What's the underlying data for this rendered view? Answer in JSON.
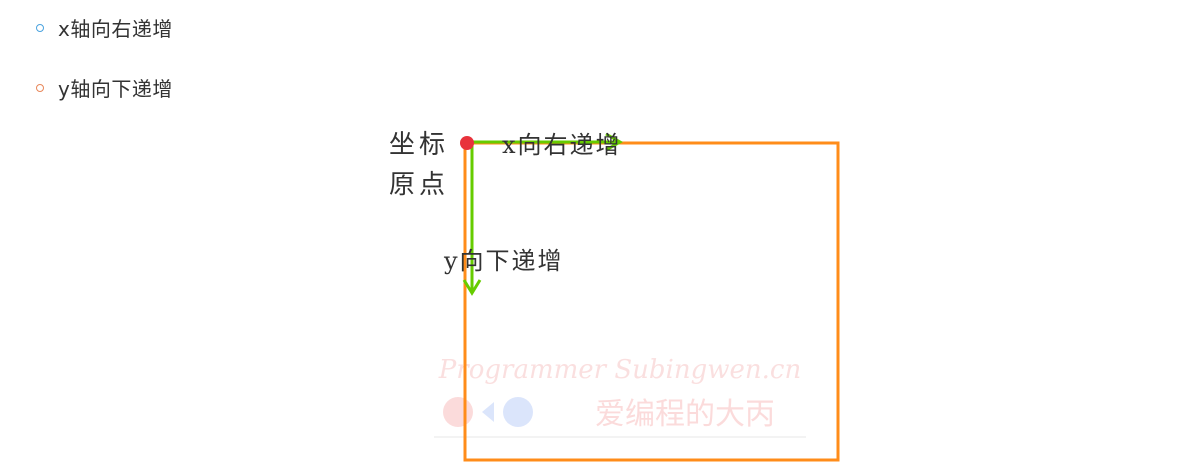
{
  "bullets": [
    {
      "text": "x轴向右递增",
      "marker_color": "#4aa3df"
    },
    {
      "text": "y轴向下递增",
      "marker_color": "#e8875a"
    }
  ],
  "diagram": {
    "origin_label_line1": "坐标",
    "origin_label_line2": "原点",
    "x_axis_label": "x向右递增",
    "y_axis_label": "y向下递增",
    "watermark_line1": "Programmer Subingwen.cn",
    "watermark_line2": "爱编程的大丙",
    "colors": {
      "rect": "#ff8c1a",
      "axis": "#66cc00",
      "origin": "#e8323c",
      "text": "#333333",
      "watermark": "#f3c6c6"
    }
  }
}
